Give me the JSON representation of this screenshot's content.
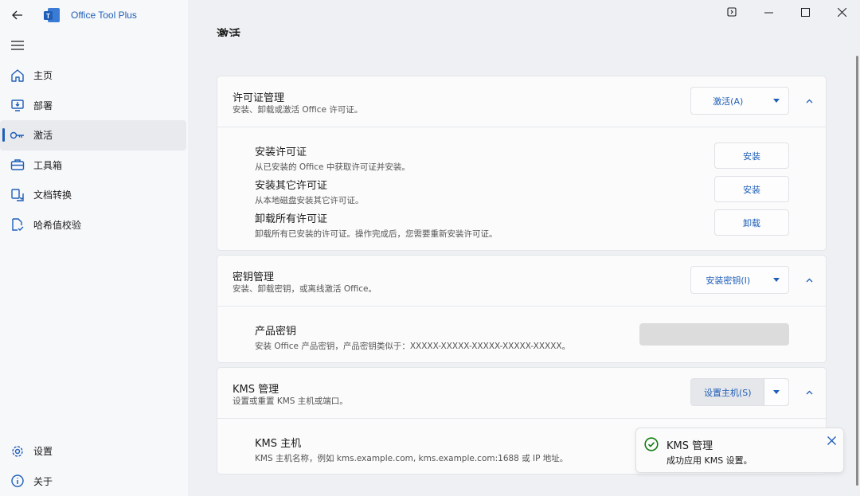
{
  "app": {
    "title": "Office Tool Plus"
  },
  "nav": {
    "items": [
      {
        "label": "主页",
        "icon": "home-icon"
      },
      {
        "label": "部署",
        "icon": "deploy-icon"
      },
      {
        "label": "激活",
        "icon": "key-icon",
        "active": true
      },
      {
        "label": "工具箱",
        "icon": "toolbox-icon"
      },
      {
        "label": "文档转换",
        "icon": "convert-icon"
      },
      {
        "label": "哈希值校验",
        "icon": "hash-check-icon"
      }
    ],
    "bottom": [
      {
        "label": "设置",
        "icon": "gear-icon"
      },
      {
        "label": "关于",
        "icon": "info-icon"
      }
    ]
  },
  "page": {
    "title": "激活"
  },
  "license": {
    "title": "许可证管理",
    "subtitle": "安装、卸载或激活 Office 许可证。",
    "split_label": "激活(A)",
    "rows": [
      {
        "title": "安装许可证",
        "subtitle": "从已安装的 Office 中获取许可证并安装。",
        "button": "安装"
      },
      {
        "title": "安装其它许可证",
        "subtitle": "从本地磁盘安装其它许可证。",
        "button": "安装"
      },
      {
        "title": "卸载所有许可证",
        "subtitle": "卸载所有已安装的许可证。操作完成后，您需要重新安装许可证。",
        "button": "卸载"
      }
    ]
  },
  "key": {
    "title": "密钥管理",
    "subtitle": "安装、卸载密钥，或离线激活 Office。",
    "split_label": "安装密钥(I)",
    "row_title": "产品密钥",
    "row_subtitle": "安装 Office 产品密钥，产品密钥类似于：XXXXX-XXXXX-XXXXX-XXXXX-XXXXX。",
    "input_value": ""
  },
  "kms": {
    "title": "KMS 管理",
    "subtitle": "设置或重置 KMS 主机或端口。",
    "split_label": "设置主机(S)",
    "row_title": "KMS 主机",
    "row_subtitle": "KMS 主机名称，例如 kms.example.com, kms.example.com:1688 或 IP 地址。"
  },
  "toast": {
    "title": "KMS 管理",
    "message": "成功应用 KMS 设置。"
  },
  "colors": {
    "accent": "#1f5fb8",
    "success": "#107c10"
  }
}
